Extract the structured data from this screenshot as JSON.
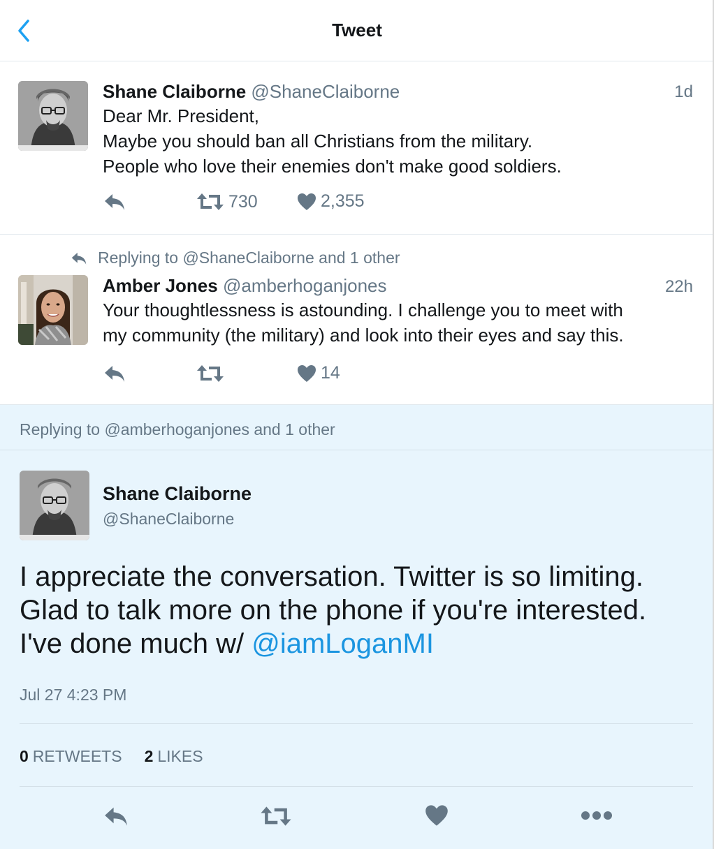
{
  "header": {
    "title": "Tweet"
  },
  "tweets": [
    {
      "name": "Shane Claiborne",
      "handle": "@ShaneClaiborne",
      "time": "1d",
      "lines": [
        "Dear Mr. President,",
        "Maybe you should ban all Christians from the military.",
        "People who love their enemies don't make good soldiers."
      ],
      "retweets": "730",
      "likes": "2,355"
    },
    {
      "reply_context": "Replying to @ShaneClaiborne and 1 other",
      "name": "Amber Jones",
      "handle": "@amberhoganjones",
      "time": "22h",
      "lines": [
        "Your thoughtlessness is astounding. I challenge you to meet with",
        "my community (the military) and look into their eyes and say this."
      ],
      "likes": "14"
    }
  ],
  "focus": {
    "reply_context": "Replying to @amberhoganjones and 1 other",
    "name": "Shane Claiborne",
    "handle": "@ShaneClaiborne",
    "lines": [
      "I appreciate the conversation. Twitter is so limiting.",
      "Glad to talk more on the phone if you're interested.",
      "I've done much w/ "
    ],
    "mention": "@iamLoganMI",
    "date": "Jul 27 4:23 PM",
    "retweet_count": "0",
    "retweet_label": "RETWEETS",
    "like_count": "2",
    "like_label": "LIKES"
  },
  "colors": {
    "accent": "#1b95e0",
    "muted": "#657786",
    "focus_bg": "#e8f5fd"
  },
  "icons": [
    "back-chevron-icon",
    "reply-icon",
    "retweet-icon",
    "heart-icon",
    "more-icon"
  ]
}
